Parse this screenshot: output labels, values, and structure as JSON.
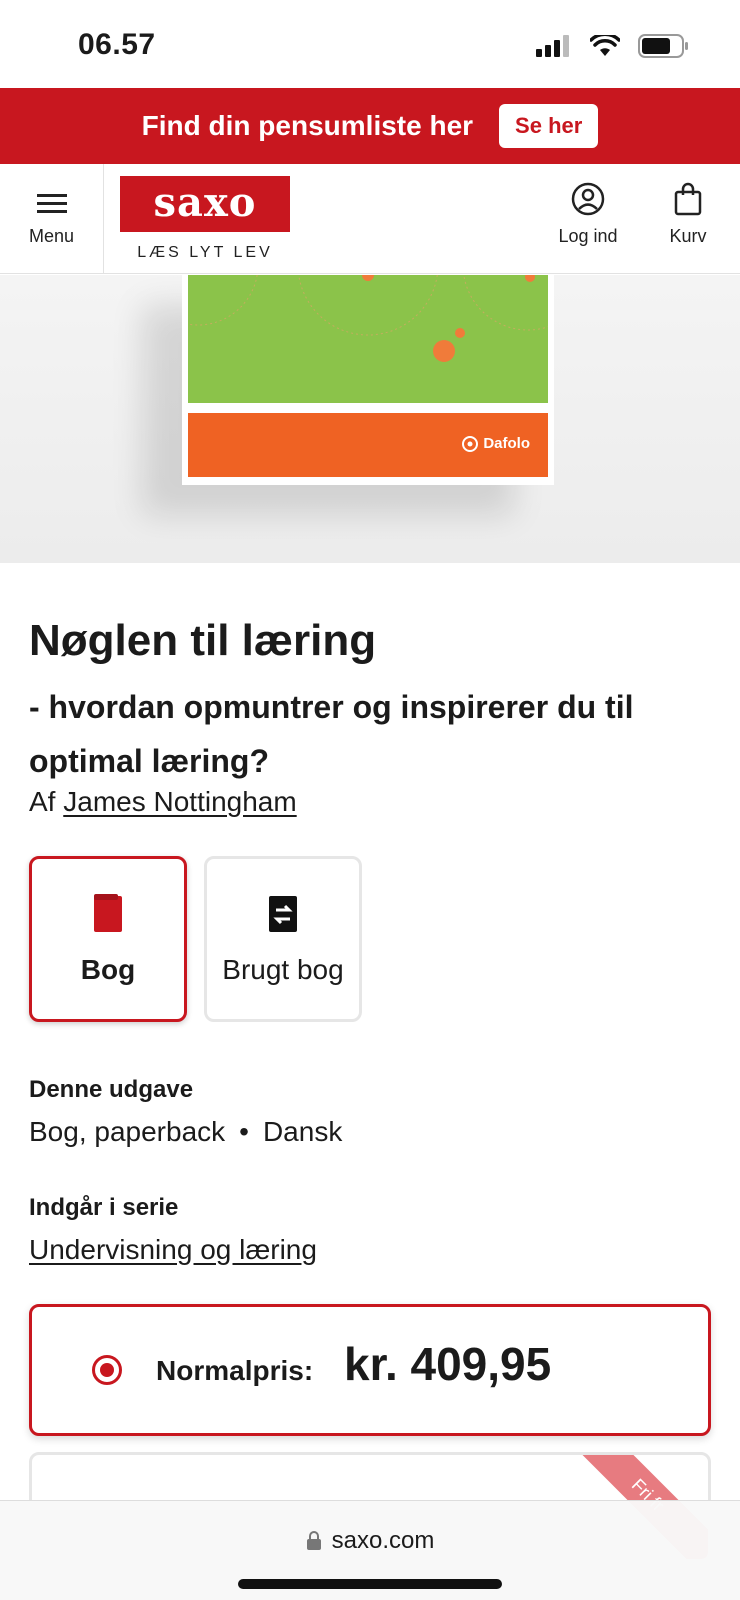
{
  "status_bar": {
    "time": "06.57"
  },
  "promo": {
    "text": "Find din pensumliste her",
    "button": "Se her"
  },
  "header": {
    "menu_label": "Menu",
    "logo": "saxo",
    "tagline": "LÆS LYT LEV",
    "login_label": "Log ind",
    "cart_label": "Kurv"
  },
  "cover": {
    "publisher": "Dafolo"
  },
  "product": {
    "title": "Nøglen til læring",
    "subtitle": "- hvordan opmuntrer og inspirerer du til optimal læring?",
    "author_prefix": "Af",
    "author": "James Nottingham"
  },
  "formats": [
    {
      "label": "Bog",
      "selected": true
    },
    {
      "label": "Brugt bog",
      "selected": false
    }
  ],
  "edition": {
    "heading": "Denne udgave",
    "type": "Bog, paperback",
    "separator": "•",
    "language": "Dansk"
  },
  "series": {
    "heading": "Indgår i serie",
    "name": "Undervisning og læring"
  },
  "price": {
    "label": "Normalpris:",
    "value": "kr. 409,95"
  },
  "second_offer": {
    "ribbon": "Fri fr"
  },
  "browser": {
    "url": "saxo.com"
  },
  "colors": {
    "brand_red": "#c8171f",
    "cover_green": "#8bc34a",
    "cover_orange": "#ef6223"
  }
}
